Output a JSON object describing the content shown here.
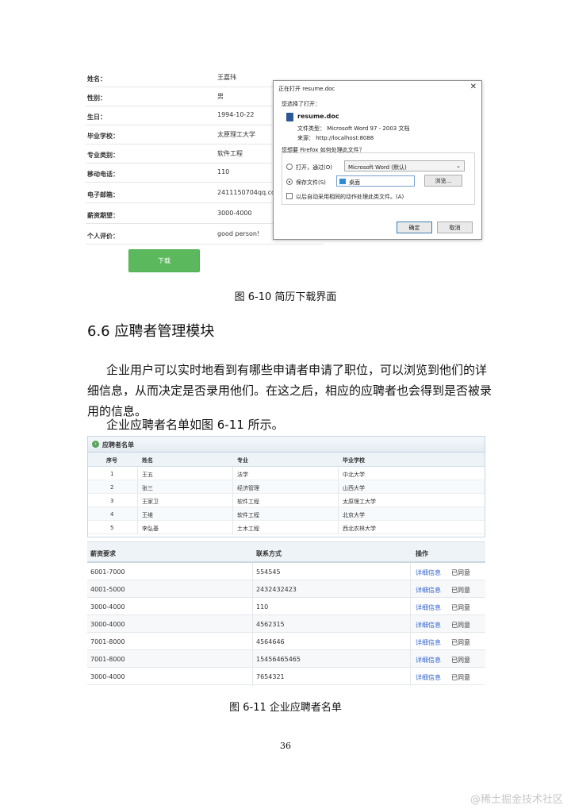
{
  "resume_form": {
    "fields": [
      {
        "label": "姓名：",
        "value": "王嘉玮"
      },
      {
        "label": "性别：",
        "value": "男"
      },
      {
        "label": "生日：",
        "value": "1994-10-22"
      },
      {
        "label": "毕业学校：",
        "value": "太原理工大学"
      },
      {
        "label": "专业类别：",
        "value": "软件工程"
      },
      {
        "label": "移动电话：",
        "value": "110"
      },
      {
        "label": "电子邮箱：",
        "value": "2411150704qq.com"
      },
      {
        "label": "薪资期望：",
        "value": "3000-4000"
      },
      {
        "label": "个人评价：",
        "value": "good person!"
      }
    ],
    "download_label": "下载"
  },
  "dialog": {
    "title": "正在打开 resume.doc",
    "close": "✕",
    "chosen_label": "您选择了打开：",
    "file_name": "resume.doc",
    "file_type": "文件类型：  Microsoft Word 97 - 2003 文档",
    "file_source": "来源：  http://localhost:8088",
    "question": "您想要 Firefox 如何处理此文件？",
    "open_with_label": "打开，通过(O)",
    "open_with_app": "Microsoft Word (默认)",
    "save_label": "保存文件(S)",
    "save_target": "桌面",
    "browse_label": "浏览...",
    "auto_label": "以后自动采用相同的动作处理此类文件。(A)",
    "ok_label": "确定",
    "cancel_label": "取消"
  },
  "caption_1": "图 6-10 简历下载界面",
  "section_heading": "6.6 应聘者管理模块",
  "paragraph_1": "企业用户可以实时地看到有哪些申请者申请了职位，可以浏览到他们的详细信息，从而决定是否录用他们。在这之后，相应的应聘者也会得到是否被录用的信息。",
  "paragraph_2": "企业应聘者名单如图 6-11 所示。",
  "applicant_panel": {
    "title": "应聘者名单",
    "columns": [
      "序号",
      "姓名",
      "专业",
      "毕业学校"
    ],
    "rows": [
      [
        "1",
        "王五",
        "法学",
        "中北大学"
      ],
      [
        "2",
        "张三",
        "经济管理",
        "山西大学"
      ],
      [
        "3",
        "王家卫",
        "软件工程",
        "太原理工大学"
      ],
      [
        "4",
        "王维",
        "软件工程",
        "北京大学"
      ],
      [
        "5",
        "李弘基",
        "土木工程",
        "西北农林大学"
      ]
    ]
  },
  "salary_table": {
    "columns": [
      "薪资要求",
      "联系方式",
      "操作"
    ],
    "detail_label": "详细信息",
    "status_label": "已同意",
    "rows": [
      [
        "6001-7000",
        "554545"
      ],
      [
        "4001-5000",
        "2432432423"
      ],
      [
        "3000-4000",
        "110"
      ],
      [
        "3000-4000",
        "4562315"
      ],
      [
        "7001-8000",
        "4564646"
      ],
      [
        "7001-8000",
        "15456465465"
      ],
      [
        "3000-4000",
        "7654321"
      ]
    ]
  },
  "caption_2": "图 6-11 企业应聘者名单",
  "page_number": "36",
  "footer_mark": "@稀土掘金技术社区"
}
